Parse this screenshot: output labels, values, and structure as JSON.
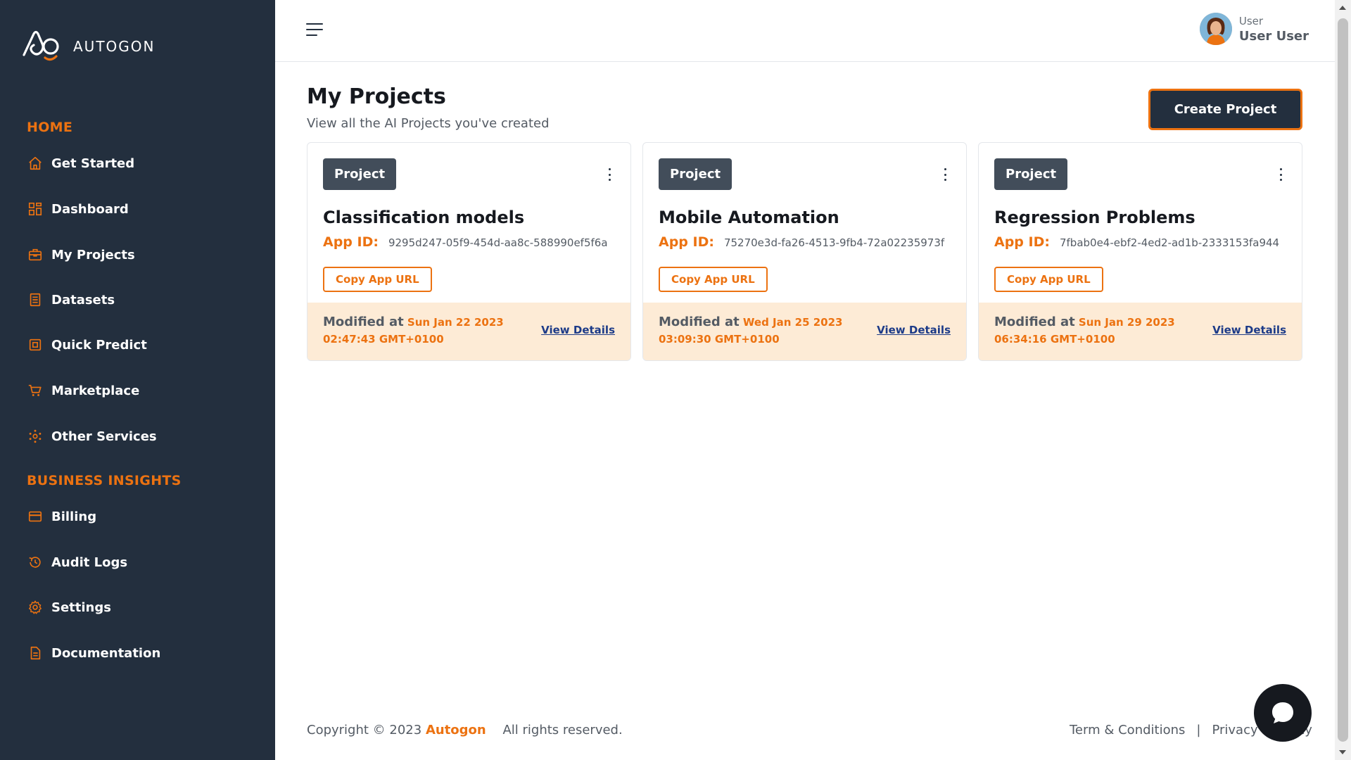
{
  "brand": {
    "name": "AUTOGON",
    "accent": "#ec7211",
    "sidebar_bg": "#232f3e"
  },
  "sidebar": {
    "sections": [
      {
        "title": "HOME"
      },
      {
        "title": "BUSINESS INSIGHTS"
      }
    ],
    "items": [
      {
        "label": "Get Started",
        "icon": "home-icon"
      },
      {
        "label": "Dashboard",
        "icon": "dashboard-grid-icon"
      },
      {
        "label": "My Projects",
        "icon": "briefcase-icon"
      },
      {
        "label": "Datasets",
        "icon": "list-document-icon"
      },
      {
        "label": "Quick Predict",
        "icon": "cpu-icon"
      },
      {
        "label": "Marketplace",
        "icon": "cart-icon"
      },
      {
        "label": "Other Services",
        "icon": "services-icon"
      },
      {
        "label": "Billing",
        "icon": "credit-card-icon"
      },
      {
        "label": "Audit Logs",
        "icon": "history-icon"
      },
      {
        "label": "Settings",
        "icon": "gear-icon"
      },
      {
        "label": "Documentation",
        "icon": "document-icon"
      }
    ]
  },
  "header": {
    "user_role": "User",
    "user_name": "User User"
  },
  "main": {
    "title": "My Projects",
    "subtitle": "View all the AI Projects you've created",
    "create_button": "Create Project",
    "projects": [
      {
        "badge": "Project",
        "name": "Classification models",
        "app_id_label": "App ID:",
        "app_id": "9295d247-05f9-454d-aa8c-588990ef5f6a",
        "copy_label": "Copy App URL",
        "modified_label": "Modified at",
        "modified_date": "Sun Jan 22 2023 02:47:43 GMT+0100",
        "view_label": "View Details"
      },
      {
        "badge": "Project",
        "name": "Mobile Automation",
        "app_id_label": "App ID:",
        "app_id": "75270e3d-fa26-4513-9fb4-72a02235973f",
        "copy_label": "Copy App URL",
        "modified_label": "Modified at",
        "modified_date": "Wed Jan 25 2023 03:09:30 GMT+0100",
        "view_label": "View Details"
      },
      {
        "badge": "Project",
        "name": "Regression Problems",
        "app_id_label": "App ID:",
        "app_id": "7fbab0e4-ebf2-4ed2-ad1b-2333153fa944",
        "copy_label": "Copy App URL",
        "modified_label": "Modified at",
        "modified_date": "Sun Jan 29 2023 06:34:16 GMT+0100",
        "view_label": "View Details"
      }
    ]
  },
  "footer": {
    "copyright_prefix": "Copyright © 2023",
    "copyright_brand": "Autogon",
    "rights": "All rights reserved.",
    "terms": "Term & Conditions",
    "separator": "|",
    "privacy": "Privacy & Policy"
  }
}
